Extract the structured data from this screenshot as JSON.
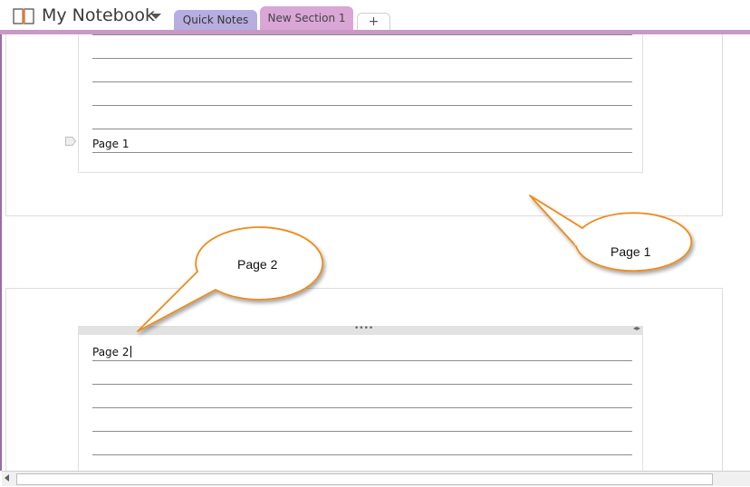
{
  "notebook": {
    "title": "My Notebook"
  },
  "tabs": [
    {
      "label": "Quick Notes",
      "color": "#b6aee0"
    },
    {
      "label": "New Section 1",
      "color": "#d9a6d6",
      "active": true
    },
    {
      "label": "+"
    }
  ],
  "accent_color": "#c998c6",
  "pages": [
    {
      "line_text": "Page 1"
    },
    {
      "line_text": "Page 2"
    }
  ],
  "callouts": [
    {
      "text": "Page 1",
      "border_color": "#f08a1a"
    },
    {
      "text": "Page 2",
      "border_color": "#f08a1a"
    }
  ],
  "icons": {
    "notebook": "notebook-icon",
    "dropdown": "chevron-down-icon",
    "tag": "note-tag-icon",
    "scroll_left": "arrow-left-icon"
  }
}
